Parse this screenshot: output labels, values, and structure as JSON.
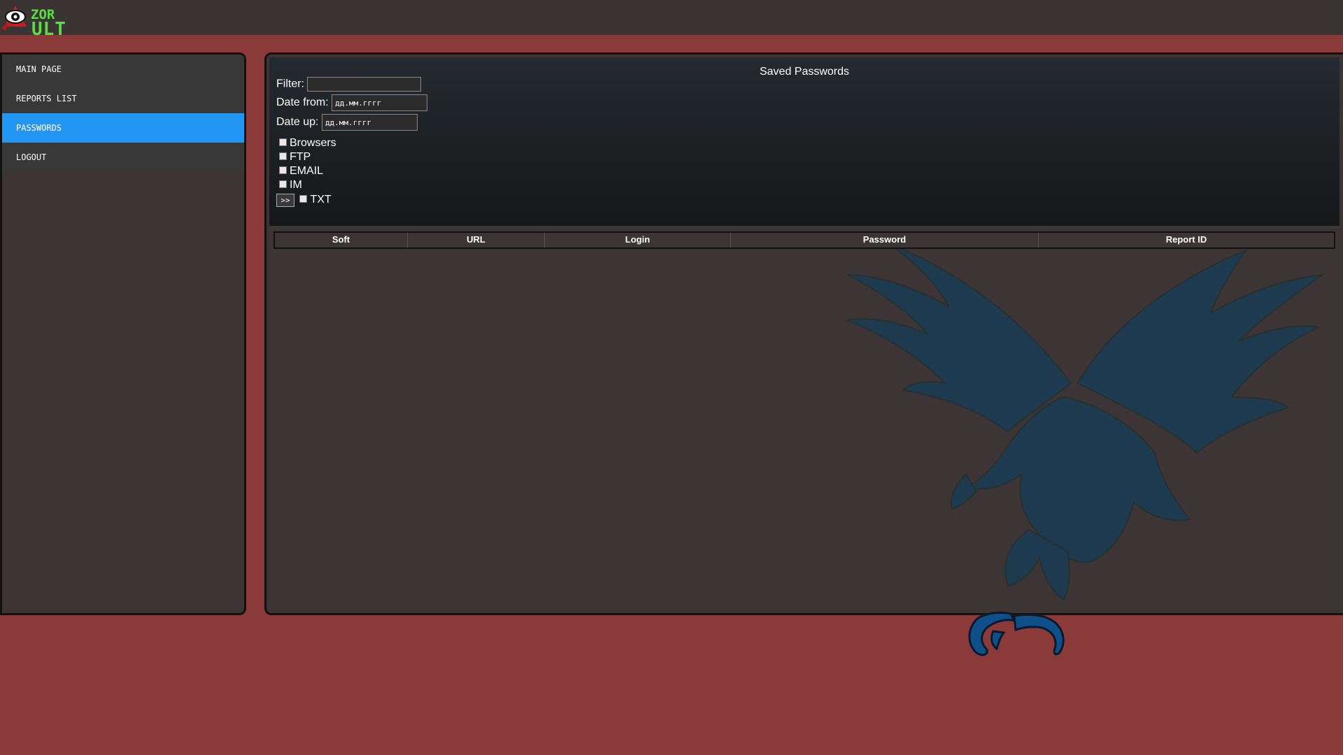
{
  "logo": {
    "word_top": "ZOR",
    "word_bottom": "ULT"
  },
  "sidebar": {
    "items": [
      {
        "label": "MAIN PAGE",
        "active": false
      },
      {
        "label": "REPORTS LIST",
        "active": false
      },
      {
        "label": "PASSWORDS",
        "active": true
      },
      {
        "label": "LOGOUT",
        "active": false
      }
    ]
  },
  "panel": {
    "title": "Saved Passwords",
    "filter_label": "Filter:",
    "filter_value": "",
    "date_from_label": "Date from:",
    "date_from_placeholder": "дд.мм.гггг",
    "date_up_label": "Date up:",
    "date_up_placeholder": "дд.мм.гггг",
    "checkboxes": [
      "Browsers",
      "FTP",
      "EMAIL",
      "IM",
      "TXT"
    ],
    "go_button": ">>"
  },
  "table": {
    "columns": [
      "Soft",
      "URL",
      "Login",
      "Password",
      "Report ID"
    ]
  },
  "colors": {
    "page_background": "#8b3a3a",
    "topbar": "#3a3434",
    "panel": "#3d3535",
    "active_nav": "#2196f3",
    "logo_green": "#55e040",
    "eagle": "#1e3a4e"
  }
}
